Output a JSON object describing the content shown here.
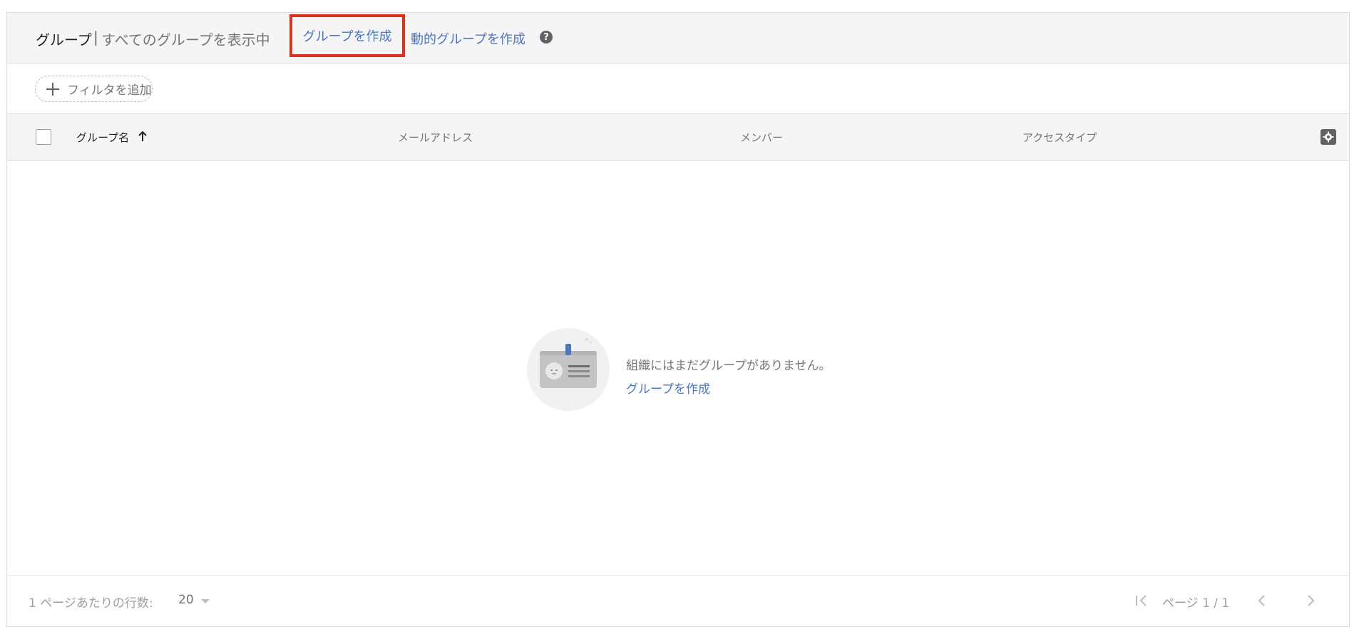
{
  "header": {
    "title": "グループ",
    "separator": "|",
    "subtitle": "すべてのグループを表示中",
    "create_group_label": "グループを作成",
    "create_dynamic_group_label": "動的グループを作成",
    "help_glyph": "?"
  },
  "filter": {
    "add_filter_label": "フィルタを追加"
  },
  "table": {
    "columns": {
      "group_name": "グループ名",
      "email": "メールアドレス",
      "members": "メンバー",
      "access_type": "アクセスタイプ"
    }
  },
  "empty_state": {
    "message": "組織にはまだグループがありません。",
    "create_label": "グループを作成"
  },
  "footer": {
    "rows_per_page_label": "1 ページあたりの行数:",
    "rows_per_page_value": "20",
    "page_label": "ページ 1 / 1"
  },
  "colors": {
    "link": "#4a77c8",
    "highlight_box": "#e0301e",
    "header_bg": "#f5f5f5"
  },
  "icons": {
    "help": "help-icon",
    "add_filter": "plus-icon",
    "sort": "arrow-up-icon",
    "settings": "gear-icon",
    "first_page": "first-page-icon",
    "prev_page": "chevron-left-icon",
    "next_page": "chevron-right-icon"
  }
}
